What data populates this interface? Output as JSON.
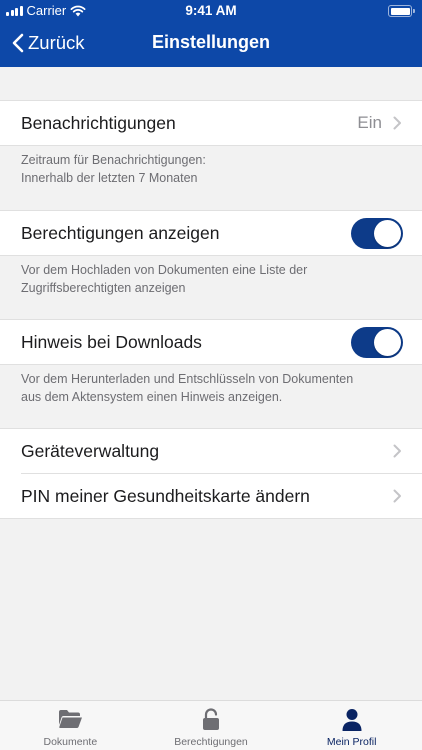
{
  "status_bar": {
    "carrier": "Carrier",
    "time": "9:41 AM"
  },
  "nav": {
    "back_label": "Zurück",
    "title": "Einstellungen"
  },
  "settings": {
    "notifications": {
      "label": "Benachrichtigungen",
      "value": "Ein"
    },
    "notifications_note": [
      "Zeitraum für Benachrichtigungen:",
      "Innerhalb der letzten 7 Monaten"
    ],
    "permissions": {
      "label": "Berechtigungen anzeigen",
      "enabled": true
    },
    "permissions_note": [
      "Vor dem Hochladen von Dokumenten eine Liste der",
      "Zugriffsberechtigten anzeigen"
    ],
    "downloads": {
      "label": "Hinweis bei Downloads",
      "enabled": true
    },
    "downloads_note": [
      "Vor dem Herunterladen und Entschlüsseln von Dokumenten",
      "aus dem Aktensystem einen Hinweis anzeigen."
    ],
    "device_management": {
      "label": "Geräteverwaltung"
    },
    "pin_change": {
      "label": "PIN meiner Gesundheitskarte ändern"
    }
  },
  "tabbar": {
    "tabs": [
      {
        "label": "Dokumente",
        "icon": "folder-icon",
        "active": false
      },
      {
        "label": "Berechtigungen",
        "icon": "unlock-icon",
        "active": false
      },
      {
        "label": "Mein Profil",
        "icon": "person-icon",
        "active": true
      }
    ]
  },
  "colors": {
    "header": "#0d48a8",
    "toggle_on": "#0d3b89",
    "active_tab": "#0a2463",
    "background": "#f2f2f2"
  }
}
